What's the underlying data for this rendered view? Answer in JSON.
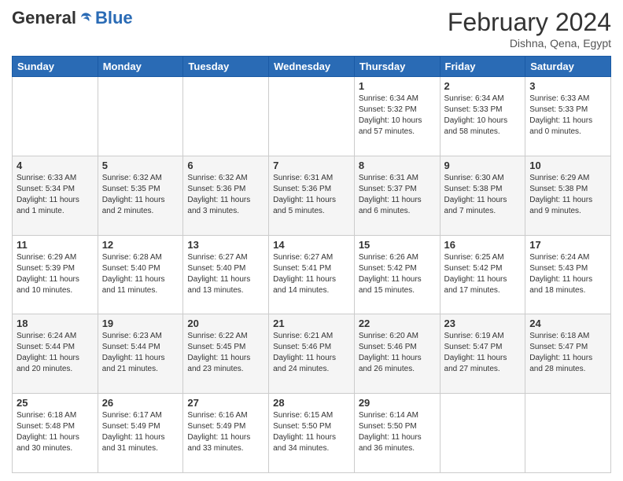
{
  "logo": {
    "general": "General",
    "blue": "Blue"
  },
  "header": {
    "month": "February 2024",
    "location": "Dishna, Qena, Egypt"
  },
  "days_of_week": [
    "Sunday",
    "Monday",
    "Tuesday",
    "Wednesday",
    "Thursday",
    "Friday",
    "Saturday"
  ],
  "weeks": [
    [
      {
        "day": "",
        "info": ""
      },
      {
        "day": "",
        "info": ""
      },
      {
        "day": "",
        "info": ""
      },
      {
        "day": "",
        "info": ""
      },
      {
        "day": "1",
        "info": "Sunrise: 6:34 AM\nSunset: 5:32 PM\nDaylight: 10 hours and 57 minutes."
      },
      {
        "day": "2",
        "info": "Sunrise: 6:34 AM\nSunset: 5:33 PM\nDaylight: 10 hours and 58 minutes."
      },
      {
        "day": "3",
        "info": "Sunrise: 6:33 AM\nSunset: 5:33 PM\nDaylight: 11 hours and 0 minutes."
      }
    ],
    [
      {
        "day": "4",
        "info": "Sunrise: 6:33 AM\nSunset: 5:34 PM\nDaylight: 11 hours and 1 minute."
      },
      {
        "day": "5",
        "info": "Sunrise: 6:32 AM\nSunset: 5:35 PM\nDaylight: 11 hours and 2 minutes."
      },
      {
        "day": "6",
        "info": "Sunrise: 6:32 AM\nSunset: 5:36 PM\nDaylight: 11 hours and 3 minutes."
      },
      {
        "day": "7",
        "info": "Sunrise: 6:31 AM\nSunset: 5:36 PM\nDaylight: 11 hours and 5 minutes."
      },
      {
        "day": "8",
        "info": "Sunrise: 6:31 AM\nSunset: 5:37 PM\nDaylight: 11 hours and 6 minutes."
      },
      {
        "day": "9",
        "info": "Sunrise: 6:30 AM\nSunset: 5:38 PM\nDaylight: 11 hours and 7 minutes."
      },
      {
        "day": "10",
        "info": "Sunrise: 6:29 AM\nSunset: 5:38 PM\nDaylight: 11 hours and 9 minutes."
      }
    ],
    [
      {
        "day": "11",
        "info": "Sunrise: 6:29 AM\nSunset: 5:39 PM\nDaylight: 11 hours and 10 minutes."
      },
      {
        "day": "12",
        "info": "Sunrise: 6:28 AM\nSunset: 5:40 PM\nDaylight: 11 hours and 11 minutes."
      },
      {
        "day": "13",
        "info": "Sunrise: 6:27 AM\nSunset: 5:40 PM\nDaylight: 11 hours and 13 minutes."
      },
      {
        "day": "14",
        "info": "Sunrise: 6:27 AM\nSunset: 5:41 PM\nDaylight: 11 hours and 14 minutes."
      },
      {
        "day": "15",
        "info": "Sunrise: 6:26 AM\nSunset: 5:42 PM\nDaylight: 11 hours and 15 minutes."
      },
      {
        "day": "16",
        "info": "Sunrise: 6:25 AM\nSunset: 5:42 PM\nDaylight: 11 hours and 17 minutes."
      },
      {
        "day": "17",
        "info": "Sunrise: 6:24 AM\nSunset: 5:43 PM\nDaylight: 11 hours and 18 minutes."
      }
    ],
    [
      {
        "day": "18",
        "info": "Sunrise: 6:24 AM\nSunset: 5:44 PM\nDaylight: 11 hours and 20 minutes."
      },
      {
        "day": "19",
        "info": "Sunrise: 6:23 AM\nSunset: 5:44 PM\nDaylight: 11 hours and 21 minutes."
      },
      {
        "day": "20",
        "info": "Sunrise: 6:22 AM\nSunset: 5:45 PM\nDaylight: 11 hours and 23 minutes."
      },
      {
        "day": "21",
        "info": "Sunrise: 6:21 AM\nSunset: 5:46 PM\nDaylight: 11 hours and 24 minutes."
      },
      {
        "day": "22",
        "info": "Sunrise: 6:20 AM\nSunset: 5:46 PM\nDaylight: 11 hours and 26 minutes."
      },
      {
        "day": "23",
        "info": "Sunrise: 6:19 AM\nSunset: 5:47 PM\nDaylight: 11 hours and 27 minutes."
      },
      {
        "day": "24",
        "info": "Sunrise: 6:18 AM\nSunset: 5:47 PM\nDaylight: 11 hours and 28 minutes."
      }
    ],
    [
      {
        "day": "25",
        "info": "Sunrise: 6:18 AM\nSunset: 5:48 PM\nDaylight: 11 hours and 30 minutes."
      },
      {
        "day": "26",
        "info": "Sunrise: 6:17 AM\nSunset: 5:49 PM\nDaylight: 11 hours and 31 minutes."
      },
      {
        "day": "27",
        "info": "Sunrise: 6:16 AM\nSunset: 5:49 PM\nDaylight: 11 hours and 33 minutes."
      },
      {
        "day": "28",
        "info": "Sunrise: 6:15 AM\nSunset: 5:50 PM\nDaylight: 11 hours and 34 minutes."
      },
      {
        "day": "29",
        "info": "Sunrise: 6:14 AM\nSunset: 5:50 PM\nDaylight: 11 hours and 36 minutes."
      },
      {
        "day": "",
        "info": ""
      },
      {
        "day": "",
        "info": ""
      }
    ]
  ]
}
